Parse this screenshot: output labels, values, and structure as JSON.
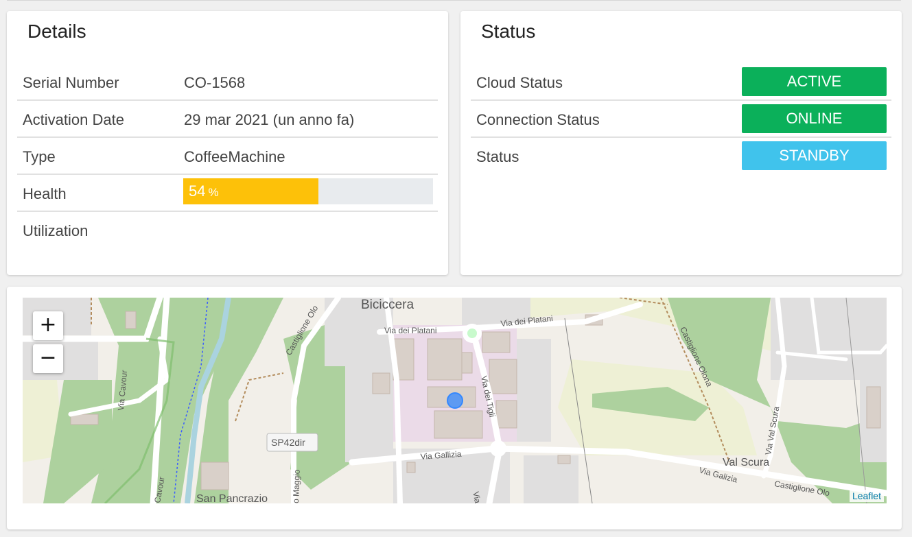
{
  "details": {
    "title": "Details",
    "rows": [
      {
        "label": "Serial Number",
        "value": "CO-1568"
      },
      {
        "label": "Activation Date",
        "value": "29 mar 2021 (un anno fa)"
      },
      {
        "label": "Type",
        "value": "CoffeeMachine"
      },
      {
        "label": "Health",
        "percent": 54,
        "value": "54",
        "unit": "%"
      },
      {
        "label": "Utilization",
        "value": ""
      }
    ]
  },
  "status": {
    "title": "Status",
    "rows": [
      {
        "label": "Cloud Status",
        "badge": "ACTIVE",
        "color": "#0bb05a"
      },
      {
        "label": "Connection Status",
        "badge": "ONLINE",
        "color": "#0bb05a"
      },
      {
        "label": "Status",
        "badge": "STANDBY",
        "color": "#40c3ec"
      }
    ]
  },
  "map": {
    "zoom_in": "+",
    "zoom_out": "−",
    "attribution": "Leaflet",
    "labels": {
      "biciccera": "Biciccera",
      "via_dei_platani": "Via dei Platani",
      "via_dei_platani_2": "Via dei Platani",
      "via_dei_tigli": "Via dei Tigli",
      "via_gallizia": "Via Gallizia",
      "via_galizia": "Via Galizia",
      "via_cavour": "Via Cavour",
      "via_cavour_2": "Cavour",
      "castiglione_olona_1": "Castiglione Olo",
      "castiglione_olona_2": "Castiglione Olona",
      "castiglione_olona_3": "Castiglione Olo",
      "via_val_scura": "Via Val Scura",
      "val_scura": "Val Scura",
      "sp42dir": "SP42dir",
      "san_pancrazio": "San Pancrazio",
      "via_maggio": "o Maggio",
      "via_partial": "Via"
    }
  }
}
